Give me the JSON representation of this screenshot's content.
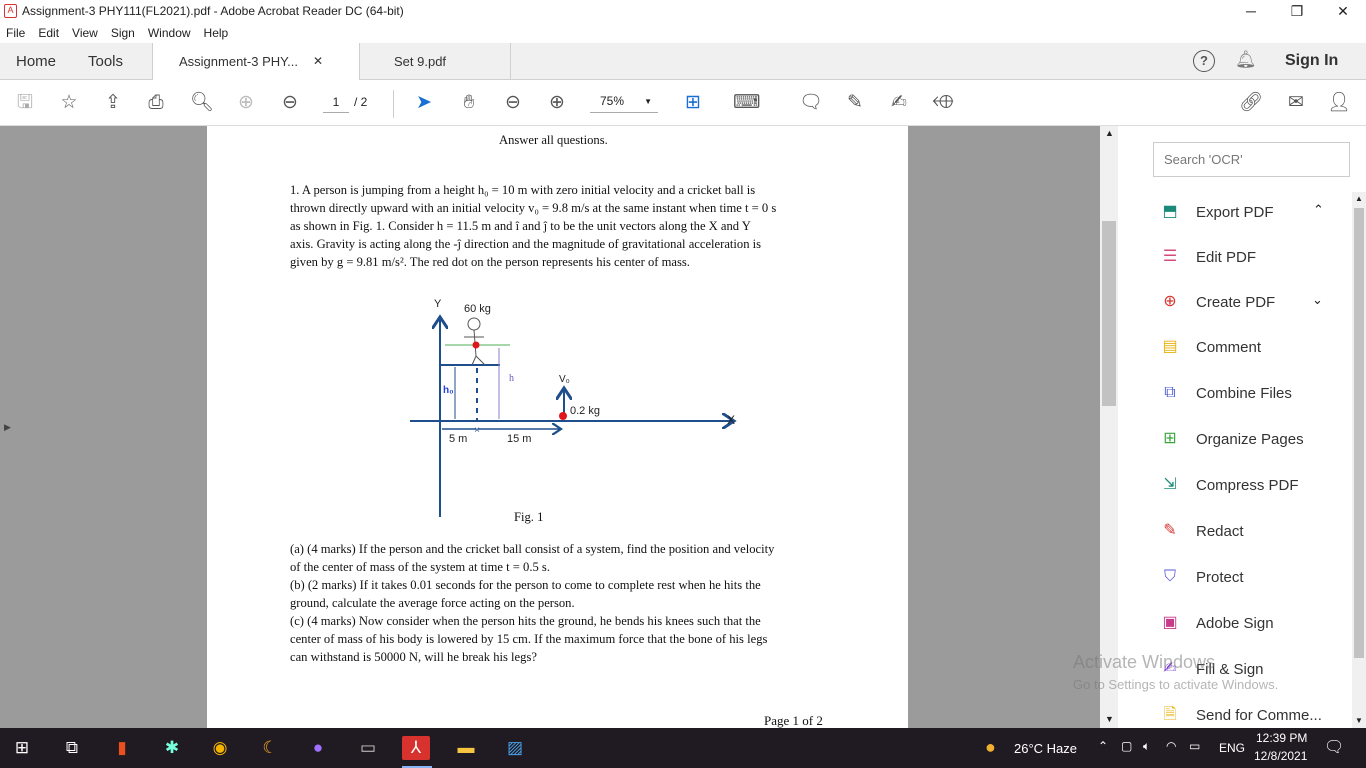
{
  "window": {
    "title": "Assignment-3 PHY111(FL2021).pdf - Adobe Acrobat Reader DC (64-bit)"
  },
  "menu": [
    "File",
    "Edit",
    "View",
    "Sign",
    "Window",
    "Help"
  ],
  "tabs": {
    "home": "Home",
    "tools": "Tools",
    "active": "Assignment-3 PHY...",
    "second": "Set 9.pdf",
    "sign_in": "Sign In"
  },
  "toolbar": {
    "page_current": "1",
    "page_total": "/ 2",
    "zoom": "75%"
  },
  "document": {
    "heading": "Answer all questions.",
    "q1": [
      "1. A person is jumping from a height h₀ = 10 m with zero initial velocity and a cricket ball is",
      "thrown directly upward with an initial velocity  v₀ = 9.8 m/s at the same instant when time t = 0 s",
      "as shown in Fig. 1. Consider h = 11.5 m and î and ĵ  to be the unit vectors along the X and Y",
      "axis. Gravity is acting along the -ĵ direction and the magnitude of gravitational acceleration is",
      "given by g = 9.81 m/s². The red dot on the person represents his center of mass."
    ],
    "figure": {
      "y_label": "Y",
      "x_label": "X",
      "person_mass": "60 kg",
      "ball_mass": "0.2 kg",
      "h0_label": "h₀",
      "h_label": "h",
      "v0_label": "V₀",
      "dist1": "5 m",
      "dist2": "15 m",
      "caption": "Fig. 1"
    },
    "parts": [
      "(a) (4 marks) If the person and the cricket ball consist of a system, find the position and velocity",
      "of the center of mass of the system at time t = 0.5 s.",
      "(b) (2 marks) If it takes 0.01 seconds for the person to come to complete rest when he hits the",
      "ground, calculate the average force acting on the person.",
      "(c) (4 marks) Now consider when the person hits the ground, he bends his knees such that the",
      "center of mass of his body is lowered by 15 cm. If the maximum force that the bone of his legs",
      "can withstand is 50000 N, will he break his legs?"
    ],
    "footer": "Page 1 of 2"
  },
  "right_panel": {
    "search_placeholder": "Search 'OCR'",
    "tools": [
      {
        "label": "Export PDF",
        "color": "#1c8a7a"
      },
      {
        "label": "Edit PDF",
        "color": "#d44a7a"
      },
      {
        "label": "Create PDF",
        "color": "#d8322f"
      },
      {
        "label": "Comment",
        "color": "#e7b20e"
      },
      {
        "label": "Combine Files",
        "color": "#4a5ad8"
      },
      {
        "label": "Organize Pages",
        "color": "#3aa53a"
      },
      {
        "label": "Compress PDF",
        "color": "#1c8a7a"
      },
      {
        "label": "Redact",
        "color": "#d8322f"
      },
      {
        "label": "Protect",
        "color": "#5a5ad8"
      },
      {
        "label": "Adobe Sign",
        "color": "#c83a8a"
      },
      {
        "label": "Fill & Sign",
        "color": "#7a3ad8"
      },
      {
        "label": "Send for Comme...",
        "color": "#e7b20e"
      }
    ]
  },
  "watermark": {
    "line1": "Activate Windows",
    "line2": "Go to Settings to activate Windows."
  },
  "taskbar": {
    "weather": "26°C  Haze",
    "lang": "ENG",
    "time": "12:39 PM",
    "date": "12/8/2021"
  }
}
